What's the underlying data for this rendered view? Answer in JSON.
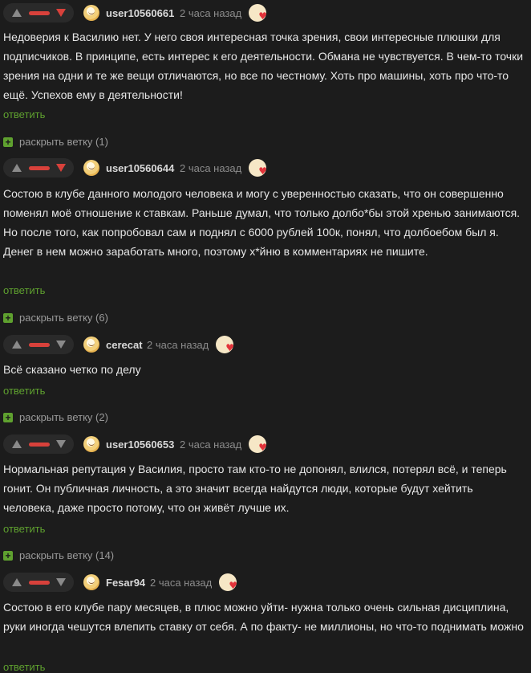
{
  "comments": [
    {
      "username": "user10560661",
      "time": "2 часа назад",
      "text": "Недоверия к Василию нет. У него своя интересная точка зрения, свои интересные плюшки для подписчиков. В принципе, есть интерес к его деятельности. Обмана не чувствуется. В чем-то точки зрения на одни и те же вещи отличаются, но все по честному. Хоть про машины, хоть про что-то ещё. Успехов ему в деятельности!",
      "reply": "ответить",
      "expand": "раскрыть ветку (1)"
    },
    {
      "username": "user10560644",
      "time": "2 часа назад",
      "text": "Состою в клубе данного молодого человека и могу с уверенностью сказать, что он совершенно поменял моё отношение к ставкам. Раньше думал, что только долбо*бы этой хренью занимаются. Но после того, как попробовал сам и поднял с 6000 рублей 100к, понял, что долбоебом был я. Денег в нем можно заработать много, поэтому х*йню в комментариях не пишите.",
      "reply": "ответить",
      "expand": "раскрыть ветку (6)"
    },
    {
      "username": "cerecat",
      "time": "2 часа назад",
      "text": "Всё сказано четко по делу",
      "reply": "ответить",
      "expand": "раскрыть ветку (2)"
    },
    {
      "username": "user10560653",
      "time": "2 часа назад",
      "text": "Нормальная репутация у Василия, просто там кто-то не допонял, влился, потерял всё, и теперь гонит. Он публичная личность, а это значит всегда найдутся люди, которые будут хейтить человека, даже просто потому, что он живёт лучше их.",
      "reply": "ответить",
      "expand": "раскрыть ветку (14)"
    },
    {
      "username": "Fesar94",
      "time": "2 часа назад",
      "text": "Состою в его клубе пару месяцев, в плюс можно уйти- нужна только очень сильная дисциплина, руки иногда чешутся влепить ставку от себя. А по факту- не миллионы, но что-то поднимать можно",
      "reply": "ответить"
    }
  ],
  "colors": {
    "background": "#1c1c1c",
    "accent_green": "#5fa12f",
    "rating_red": "#d8413b",
    "muted": "#8c8c8c"
  },
  "icons": {
    "upvote": "arrow-up-icon",
    "downvote": "arrow-down-icon",
    "avatar": "avatar-face-icon",
    "badge": "heart-badge-icon",
    "expand": "plus-icon"
  }
}
